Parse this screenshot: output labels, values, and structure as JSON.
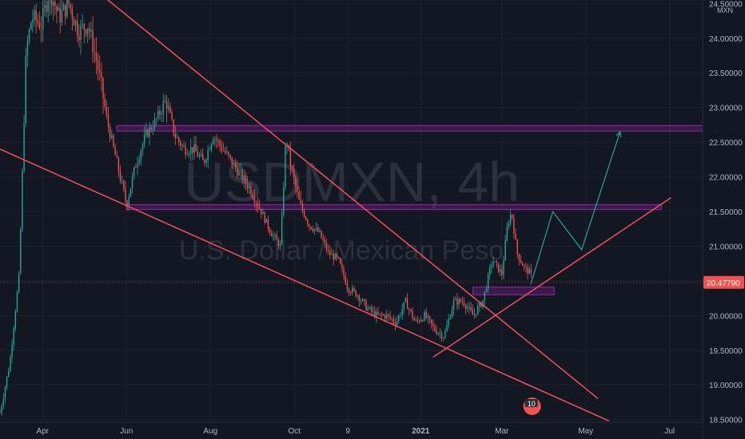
{
  "chart_data": {
    "type": "candlestick",
    "watermark": {
      "symbol": "USDMXN, 4h",
      "description": "U.S. Dollar / Mexican Peso"
    },
    "currency_label": "MXN",
    "ylim": [
      18.45,
      24.55
    ],
    "x_range": [
      "2020-03-01",
      "2021-07-25"
    ],
    "price_ticks": [
      "24.50000",
      "24.00000",
      "23.50000",
      "23.00000",
      "22.50000",
      "22.00000",
      "21.50000",
      "21.00000",
      "20.50000",
      "20.00000",
      "19.50000",
      "19.00000",
      "18.50000"
    ],
    "time_ticks": [
      {
        "label": "Apr",
        "date": "2020-04-01"
      },
      {
        "label": "Jun",
        "date": "2020-06-01"
      },
      {
        "label": "Aug",
        "date": "2020-08-01"
      },
      {
        "label": "Oct",
        "date": "2020-10-01"
      },
      {
        "label": "9",
        "date": "2020-11-09"
      },
      {
        "label": "2021",
        "date": "2021-01-01",
        "bold": true
      },
      {
        "label": "Mar",
        "date": "2021-03-01"
      },
      {
        "label": "May",
        "date": "2021-05-01"
      },
      {
        "label": "Jul",
        "date": "2021-07-01"
      }
    ],
    "last_price": {
      "label": "20.47790",
      "value": 20.4779
    },
    "price_path": [
      [
        "2020-03-01",
        18.6
      ],
      [
        "2020-03-08",
        19.3
      ],
      [
        "2020-03-15",
        20.6
      ],
      [
        "2020-03-20",
        23.8
      ],
      [
        "2020-03-24",
        24.3
      ],
      [
        "2020-03-31",
        24.2
      ],
      [
        "2020-04-06",
        24.7
      ],
      [
        "2020-04-13",
        24.3
      ],
      [
        "2020-04-20",
        24.5
      ],
      [
        "2020-04-27",
        24.1
      ],
      [
        "2020-05-04",
        24.2
      ],
      [
        "2020-05-11",
        23.6
      ],
      [
        "2020-05-18",
        22.8
      ],
      [
        "2020-05-25",
        22.2
      ],
      [
        "2020-06-01",
        21.6
      ],
      [
        "2020-06-08",
        22.2
      ],
      [
        "2020-06-15",
        22.6
      ],
      [
        "2020-06-22",
        22.8
      ],
      [
        "2020-06-30",
        23.1
      ],
      [
        "2020-07-06",
        22.6
      ],
      [
        "2020-07-13",
        22.4
      ],
      [
        "2020-07-20",
        22.4
      ],
      [
        "2020-07-27",
        22.2
      ],
      [
        "2020-08-03",
        22.6
      ],
      [
        "2020-08-10",
        22.4
      ],
      [
        "2020-08-17",
        22.2
      ],
      [
        "2020-08-24",
        22.0
      ],
      [
        "2020-08-31",
        21.8
      ],
      [
        "2020-09-07",
        21.5
      ],
      [
        "2020-09-14",
        21.2
      ],
      [
        "2020-09-21",
        21.0
      ],
      [
        "2020-09-25",
        22.6
      ],
      [
        "2020-09-28",
        22.2
      ],
      [
        "2020-10-05",
        21.6
      ],
      [
        "2020-10-12",
        21.3
      ],
      [
        "2020-10-19",
        21.2
      ],
      [
        "2020-10-26",
        20.9
      ],
      [
        "2020-11-02",
        20.8
      ],
      [
        "2020-11-09",
        20.4
      ],
      [
        "2020-11-16",
        20.3
      ],
      [
        "2020-11-23",
        20.1
      ],
      [
        "2020-11-30",
        20.0
      ],
      [
        "2020-12-07",
        20.0
      ],
      [
        "2020-12-14",
        19.9
      ],
      [
        "2020-12-21",
        20.2
      ],
      [
        "2020-12-28",
        19.9
      ],
      [
        "2021-01-04",
        20.0
      ],
      [
        "2021-01-11",
        19.8
      ],
      [
        "2021-01-18",
        19.7
      ],
      [
        "2021-01-25",
        20.2
      ],
      [
        "2021-02-01",
        20.2
      ],
      [
        "2021-02-08",
        20.0
      ],
      [
        "2021-02-15",
        20.2
      ],
      [
        "2021-02-22",
        20.8
      ],
      [
        "2021-03-01",
        20.6
      ],
      [
        "2021-03-05",
        21.3
      ],
      [
        "2021-03-08",
        21.5
      ],
      [
        "2021-03-12",
        20.9
      ],
      [
        "2021-03-17",
        20.7
      ],
      [
        "2021-03-22",
        20.6
      ],
      [
        "2021-03-23",
        20.48
      ]
    ],
    "drawings": {
      "zones": [
        {
          "from": "2020-05-25",
          "to": "2021-07-25",
          "low": 22.66,
          "high": 22.74
        },
        {
          "from": "2020-06-01",
          "to": "2021-06-25",
          "low": 21.53,
          "high": 21.6
        },
        {
          "from": "2021-02-08",
          "to": "2021-04-08",
          "low": 20.3,
          "high": 20.41
        }
      ],
      "trendlines": [
        {
          "p1": [
            "2020-03-01",
            22.4
          ],
          "p2": [
            "2021-05-18",
            18.48
          ]
        },
        {
          "p1": [
            "2020-05-03",
            24.8
          ],
          "p2": [
            "2021-05-10",
            18.8
          ]
        },
        {
          "p1": [
            "2021-01-10",
            19.4
          ],
          "p2": [
            "2021-07-02",
            21.7
          ]
        }
      ],
      "projection": [
        [
          "2021-03-22",
          20.45
        ],
        [
          "2021-04-07",
          21.5
        ],
        [
          "2021-04-28",
          20.95
        ],
        [
          "2021-05-26",
          22.65
        ]
      ]
    },
    "badge": {
      "label": "10"
    }
  }
}
